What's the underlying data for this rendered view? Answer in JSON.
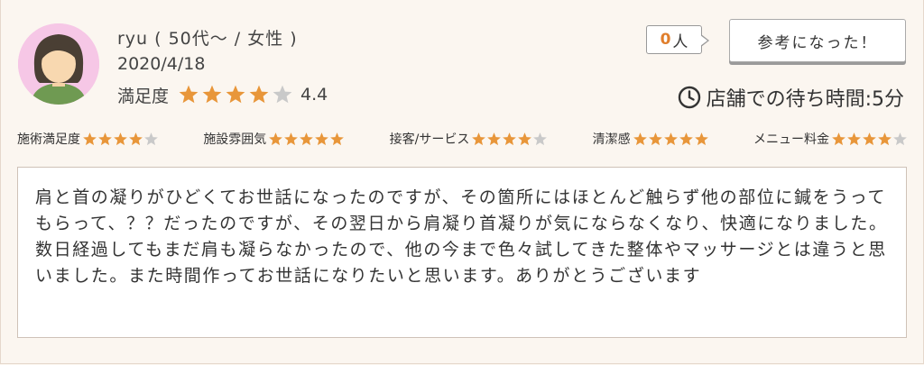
{
  "user": {
    "name": "ryu ( 50代〜 / 女性 )",
    "date": "2020/4/18"
  },
  "satisfaction": {
    "label": "満足度",
    "score": "4.4",
    "stars": 4.4
  },
  "helpful": {
    "count": "0",
    "unit": "人",
    "button_label": "参考になった！"
  },
  "wait": {
    "text": "店舗での待ち時間:5分",
    "icon": "clock-icon"
  },
  "ratings": [
    {
      "label": "施術満足度",
      "stars": 4
    },
    {
      "label": "施設雰囲気",
      "stars": 5
    },
    {
      "label": "接客/サービス",
      "stars": 4
    },
    {
      "label": "清潔感",
      "stars": 5
    },
    {
      "label": "メニュー料金",
      "stars": 4
    }
  ],
  "comment": "肩と首の凝りがひどくてお世話になったのですが、その箇所にはほとんど触らず他の部位に鍼をうってもらって、？？だったのですが、その翌日から肩凝り首凝りが気にならなくなり、快適になりました。数日経過してもまだ肩も凝らなかったので、他の今まで色々試してきた整体やマッサージとは違うと思いました。また時間作ってお世話になりたいと思います。ありがとうございます",
  "colors": {
    "star_filled": "#e8963a",
    "star_empty": "#c9c9c9",
    "accent": "#e07e2c",
    "avatar_bg": "#f6c7e6"
  }
}
